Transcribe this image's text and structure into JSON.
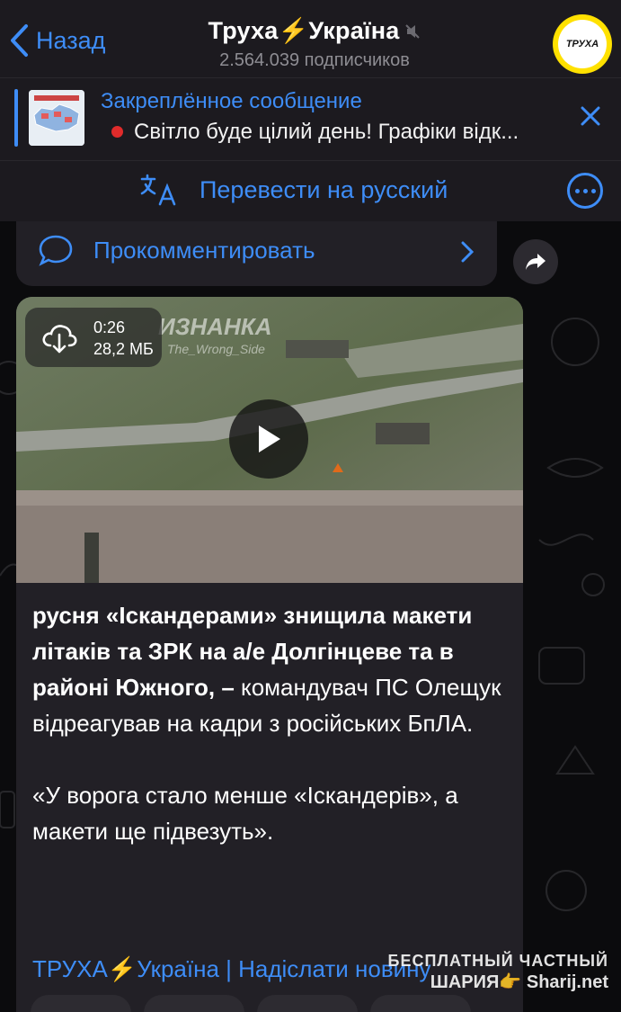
{
  "header": {
    "back_label": "Назад",
    "channel_title": "Труха⚡Україна",
    "subscribers": "2.564.039 подписчиков",
    "avatar_text": "ТРУХА"
  },
  "pinned": {
    "title": "Закреплённое сообщение",
    "text": "Світло буде цілий день! Графіки відк..."
  },
  "translate": {
    "label": "Перевести на русский"
  },
  "previous_post": {
    "comment_label": "Прокомментировать"
  },
  "post": {
    "video": {
      "duration": "0:26",
      "size": "28,2 МБ",
      "watermark": "ИЗНАНКА",
      "watermark_sub": "The_Wrong_Side"
    },
    "text_bold": "русня «Іскандерами» знищила макети літаків та ЗРК на а/е Долгінцеве та в районі Южного, –",
    "text_regular": " командувач ПС Олещук відреагував на кадри з російських БпЛА.",
    "quote": "«У ворога стало менше «Іскандерів», а макети ще підвезуть».",
    "links": "ТРУХА⚡Україна | Надіслати новину"
  },
  "watermark": {
    "line1": "БЕСПЛАТНЫЙ ЧАСТНЫЙ",
    "line2": "ШАРИЯ👉 Sharij.net"
  },
  "colors": {
    "accent": "#3e8df7",
    "bar_bg": "#1c1a1f",
    "bubble_bg": "#222026",
    "avatar_ring": "#ffe100"
  }
}
